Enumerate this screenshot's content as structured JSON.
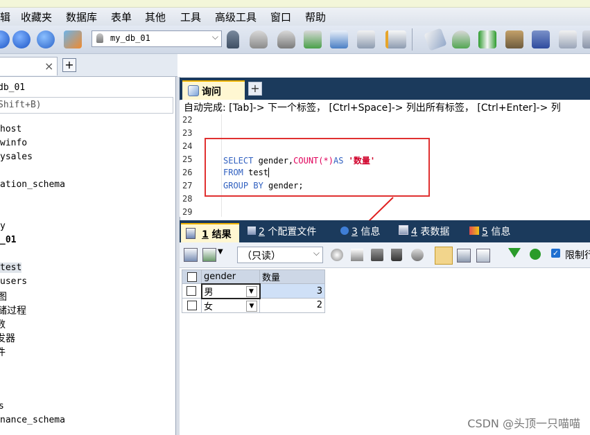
{
  "menu": [
    "辑",
    "收藏夹",
    "数据库",
    "表单",
    "其他",
    "工具",
    "高级工具",
    "窗口",
    "帮助"
  ],
  "toolbar": {
    "db_selector": "my_db_01",
    "icons": [
      "record-icon",
      "forward-icon",
      "refresh-icon",
      "users-icon",
      "db-icon",
      "user-icon",
      "db-export-icon",
      "db-import-icon",
      "backup-icon",
      "table-icon",
      "schema-icon",
      "index-icon",
      "eraser-icon",
      "db-sync-icon",
      "sync-icon",
      "truck-icon",
      "monitor-icon",
      "window-icon",
      "more-icon"
    ]
  },
  "left_pane": {
    "tree": [
      "db_01",
      "Shift+B)",
      "host",
      "winfo",
      "ysales",
      "ation_schema",
      "y",
      "_01",
      "test",
      "users",
      "图",
      "储过程",
      "数",
      "发器",
      "件",
      "s",
      "nance_schema"
    ]
  },
  "query_tab": {
    "label": "询问"
  },
  "autocomplete": "自动完成:  [Tab]-> 下一个标签，  [Ctrl+Space]-> 列出所有标签，  [Ctrl+Enter]-> 列",
  "editor": {
    "line_numbers": [
      "22",
      "23",
      "24",
      "25",
      "26",
      "27",
      "28",
      "29"
    ],
    "lines": {
      "l25": {
        "kw1": "SELECT",
        "t1": " gender,",
        "fn": "COUNT",
        "t2": "(*)",
        "kw2": "AS",
        "str": "'数量'"
      },
      "l26": {
        "kw": "FROM",
        "t": " test"
      },
      "l27": {
        "kw": "GROUP BY",
        "t": " gender;"
      }
    }
  },
  "result_tabs": [
    {
      "num": "1",
      "label": "结果"
    },
    {
      "num": "2",
      "label": "个配置文件"
    },
    {
      "num": "3",
      "label": "信息"
    },
    {
      "num": "4",
      "label": "表数据"
    },
    {
      "num": "5",
      "label": "信息"
    }
  ],
  "result_toolbar": {
    "readonly": "（只读）",
    "limit_label": "限制行"
  },
  "result_table": {
    "columns": [
      "gender",
      "数量"
    ],
    "rows": [
      [
        "男",
        "3"
      ],
      [
        "女",
        "2"
      ]
    ]
  },
  "watermark": "CSDN @头顶一只喵喵"
}
